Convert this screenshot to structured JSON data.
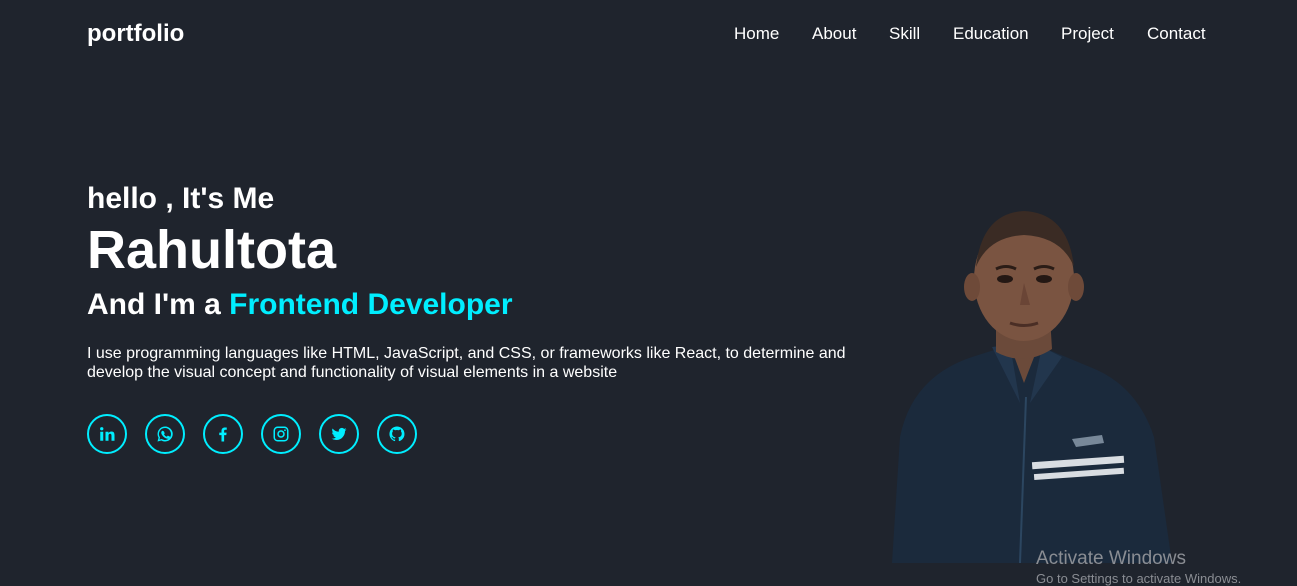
{
  "header": {
    "logo": "portfolio",
    "nav": [
      {
        "label": "Home"
      },
      {
        "label": "About"
      },
      {
        "label": "Skill"
      },
      {
        "label": "Education"
      },
      {
        "label": "Project"
      },
      {
        "label": "Contact"
      }
    ]
  },
  "hero": {
    "greeting": "hello , It's Me",
    "name": "Rahultota",
    "role_prefix": "And I'm a ",
    "role_highlight": "Frontend Developer",
    "description": "I use programming languages like HTML, JavaScript, and CSS, or frameworks like React, to determine and develop the visual concept and functionality of visual elements in a website",
    "social": [
      {
        "icon": "linkedin-icon"
      },
      {
        "icon": "whatsapp-icon"
      },
      {
        "icon": "facebook-icon"
      },
      {
        "icon": "instagram-icon"
      },
      {
        "icon": "twitter-icon"
      },
      {
        "icon": "github-icon"
      }
    ]
  },
  "watermark": {
    "title": "Activate Windows",
    "subtitle": "Go to Settings to activate Windows."
  },
  "colors": {
    "background": "#1f242d",
    "accent": "#00eeff",
    "text": "#ffffff"
  }
}
